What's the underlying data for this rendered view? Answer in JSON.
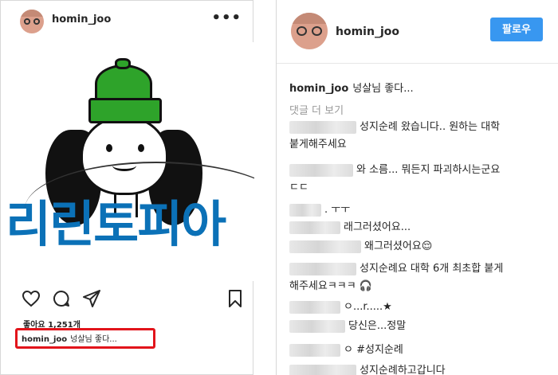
{
  "left_post": {
    "username": "homin_joo",
    "more_label": "•••",
    "post_image_text": "리린토피아",
    "likes": "좋아요 1,251개",
    "caption": {
      "username": "homin_joo",
      "text": "넝살님 좋다..."
    },
    "icons": [
      "heart-icon",
      "comment-icon",
      "share-icon",
      "bookmark-icon"
    ]
  },
  "right_panel": {
    "username": "homin_joo",
    "follow_label": "팔로우",
    "owner_comment": {
      "username": "homin_joo",
      "text": "넝살님 좋다..."
    },
    "more_comments_label": "댓글 더 보기",
    "comments": [
      {
        "text": "성지순례 왔습니다.. 원하는 대학"
      },
      {
        "text": "붙게해주세요"
      },
      {
        "text": "와 소름... 뭐든지 파괴하시는군요"
      },
      {
        "text": "ㄷㄷ"
      },
      {
        "text": ". ㅜㅜ"
      },
      {
        "text": "래그러셨어요..."
      },
      {
        "text": "왜그러셨어요😌"
      },
      {
        "text": "성지순례요 대학 6개 최초합 붙게"
      },
      {
        "text": "해주세요ㅋㅋㅋ 🎧"
      },
      {
        "text": "ㅇ...r.....★"
      },
      {
        "text": "당신은...정말"
      },
      {
        "text": "ㅇ #성지순례"
      },
      {
        "text": "성지순례하고갑니다"
      }
    ]
  },
  "colors": {
    "follow_button": "#3897f0",
    "highlight_box": "#e2141b",
    "image_text": "#0b71b7",
    "hat_green": "#2ea32a"
  }
}
